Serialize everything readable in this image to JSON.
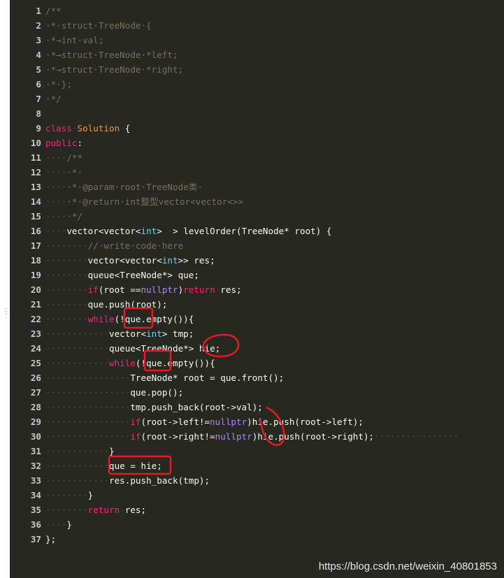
{
  "editor": {
    "theme": "monokai",
    "background": "#272822",
    "side_handle": "⋮",
    "lines": [
      {
        "n": "1",
        "tokens": [
          [
            "cm",
            "/**"
          ]
        ]
      },
      {
        "n": "2",
        "tokens": [
          [
            "cm",
            "·*·struct·TreeNode·{"
          ]
        ]
      },
      {
        "n": "3",
        "tokens": [
          [
            "cm",
            "·*→int·val;"
          ]
        ]
      },
      {
        "n": "4",
        "tokens": [
          [
            "cm",
            "·*→struct·TreeNode·*left;"
          ]
        ]
      },
      {
        "n": "5",
        "tokens": [
          [
            "cm",
            "·*→struct·TreeNode·*right;"
          ]
        ]
      },
      {
        "n": "6",
        "tokens": [
          [
            "cm",
            "·*·};"
          ]
        ]
      },
      {
        "n": "7",
        "tokens": [
          [
            "cm",
            "·*/"
          ]
        ]
      },
      {
        "n": "8",
        "tokens": []
      },
      {
        "n": "9",
        "tokens": [
          [
            "kw",
            "class"
          ],
          [
            "ws",
            "·"
          ],
          [
            "cls",
            "Solution"
          ],
          [
            "ws",
            "·"
          ],
          [
            "tx",
            "{"
          ]
        ]
      },
      {
        "n": "10",
        "tokens": [
          [
            "kw",
            "public"
          ],
          [
            "tx",
            ":"
          ]
        ]
      },
      {
        "n": "11",
        "tokens": [
          [
            "ws",
            "····"
          ],
          [
            "cm",
            "/**"
          ]
        ]
      },
      {
        "n": "12",
        "tokens": [
          [
            "ws",
            "····"
          ],
          [
            "cm",
            "·*·"
          ]
        ]
      },
      {
        "n": "13",
        "tokens": [
          [
            "ws",
            "····"
          ],
          [
            "cm",
            "·*·@param·root·TreeNode类·"
          ]
        ]
      },
      {
        "n": "14",
        "tokens": [
          [
            "ws",
            "····"
          ],
          [
            "cm",
            "·*·@return·int整型vector<vector<>>"
          ]
        ]
      },
      {
        "n": "15",
        "tokens": [
          [
            "ws",
            "····"
          ],
          [
            "cm",
            "·*/"
          ]
        ]
      },
      {
        "n": "16",
        "tokens": [
          [
            "ws",
            "····"
          ],
          [
            "tx",
            "vector<vector<"
          ],
          [
            "ty",
            "int"
          ],
          [
            "tx",
            "> "
          ],
          [
            "ws",
            "·"
          ],
          [
            "tx",
            "> "
          ],
          [
            "tx",
            "levelOrder(TreeNode* "
          ],
          [
            "tx",
            "root) "
          ],
          [
            "tx",
            "{"
          ]
        ]
      },
      {
        "n": "17",
        "tokens": [
          [
            "ws",
            "········"
          ],
          [
            "cm",
            "//·write·code·here"
          ]
        ]
      },
      {
        "n": "18",
        "tokens": [
          [
            "ws",
            "········"
          ],
          [
            "tx",
            "vector<vector<"
          ],
          [
            "ty",
            "int"
          ],
          [
            "tx",
            ">> "
          ],
          [
            "tx",
            "res;"
          ]
        ]
      },
      {
        "n": "19",
        "tokens": [
          [
            "ws",
            "········"
          ],
          [
            "tx",
            "queue<TreeNode*> "
          ],
          [
            "tx",
            "que;"
          ]
        ]
      },
      {
        "n": "20",
        "tokens": [
          [
            "ws",
            "········"
          ],
          [
            "kw",
            "if"
          ],
          [
            "tx",
            "(root "
          ],
          [
            "tx",
            "=="
          ],
          [
            "cn",
            "nullptr"
          ],
          [
            "tx",
            ")"
          ],
          [
            "kw",
            "return"
          ],
          [
            "ws",
            "·"
          ],
          [
            "tx",
            "res;"
          ]
        ]
      },
      {
        "n": "21",
        "tokens": [
          [
            "ws",
            "········"
          ],
          [
            "tx",
            "que.push(root);"
          ]
        ]
      },
      {
        "n": "22",
        "tokens": [
          [
            "ws",
            "········"
          ],
          [
            "kw",
            "while"
          ],
          [
            "tx",
            "(!que.empty()){"
          ]
        ]
      },
      {
        "n": "23",
        "tokens": [
          [
            "ws",
            "············"
          ],
          [
            "tx",
            "vector<"
          ],
          [
            "ty",
            "int"
          ],
          [
            "tx",
            "> "
          ],
          [
            "tx",
            "tmp;"
          ]
        ]
      },
      {
        "n": "24",
        "tokens": [
          [
            "ws",
            "············"
          ],
          [
            "tx",
            "queue<TreeNode*> "
          ],
          [
            "tx",
            "hie;"
          ]
        ]
      },
      {
        "n": "25",
        "tokens": [
          [
            "ws",
            "············"
          ],
          [
            "kw",
            "while"
          ],
          [
            "tx",
            "(!que.empty()){"
          ]
        ]
      },
      {
        "n": "26",
        "tokens": [
          [
            "ws",
            "················"
          ],
          [
            "tx",
            "TreeNode* "
          ],
          [
            "tx",
            "root "
          ],
          [
            "tx",
            "= "
          ],
          [
            "tx",
            "que.front();"
          ]
        ]
      },
      {
        "n": "27",
        "tokens": [
          [
            "ws",
            "················"
          ],
          [
            "tx",
            "que.pop();"
          ]
        ]
      },
      {
        "n": "28",
        "tokens": [
          [
            "ws",
            "················"
          ],
          [
            "tx",
            "tmp.push_back(root->val);"
          ]
        ]
      },
      {
        "n": "29",
        "tokens": [
          [
            "ws",
            "················"
          ],
          [
            "kw",
            "if"
          ],
          [
            "tx",
            "(root->left!="
          ],
          [
            "cn",
            "nullptr"
          ],
          [
            "tx",
            ")hie.push(root->left);"
          ]
        ]
      },
      {
        "n": "30",
        "tokens": [
          [
            "ws",
            "················"
          ],
          [
            "kw",
            "if"
          ],
          [
            "tx",
            "(root->right!="
          ],
          [
            "cn",
            "nullptr"
          ],
          [
            "tx",
            ")hie.push(root->right);"
          ],
          [
            "ws",
            "················"
          ]
        ]
      },
      {
        "n": "31",
        "tokens": [
          [
            "ws",
            "············"
          ],
          [
            "tx",
            "}"
          ]
        ]
      },
      {
        "n": "32",
        "tokens": [
          [
            "ws",
            "············"
          ],
          [
            "tx",
            "que "
          ],
          [
            "tx",
            "= "
          ],
          [
            "tx",
            "hie;"
          ]
        ]
      },
      {
        "n": "33",
        "tokens": [
          [
            "ws",
            "············"
          ],
          [
            "tx",
            "res.push_back(tmp);"
          ]
        ]
      },
      {
        "n": "34",
        "tokens": [
          [
            "ws",
            "········"
          ],
          [
            "tx",
            "}"
          ]
        ]
      },
      {
        "n": "35",
        "tokens": [
          [
            "ws",
            "········"
          ],
          [
            "kw",
            "return"
          ],
          [
            "ws",
            "·"
          ],
          [
            "tx",
            "res;"
          ]
        ]
      },
      {
        "n": "36",
        "tokens": [
          [
            "ws",
            "····"
          ],
          [
            "tx",
            "}"
          ]
        ]
      },
      {
        "n": "37",
        "tokens": [
          [
            "tx",
            "};"
          ]
        ]
      }
    ]
  },
  "annotations": {
    "color": "#e11d1d",
    "marks": [
      "box-line-22-que",
      "circle-line-24-hie",
      "box-line-25-que",
      "arc-lines-29-30",
      "box-line-32"
    ]
  },
  "watermark": "https://blog.csdn.net/weixin_40801853"
}
